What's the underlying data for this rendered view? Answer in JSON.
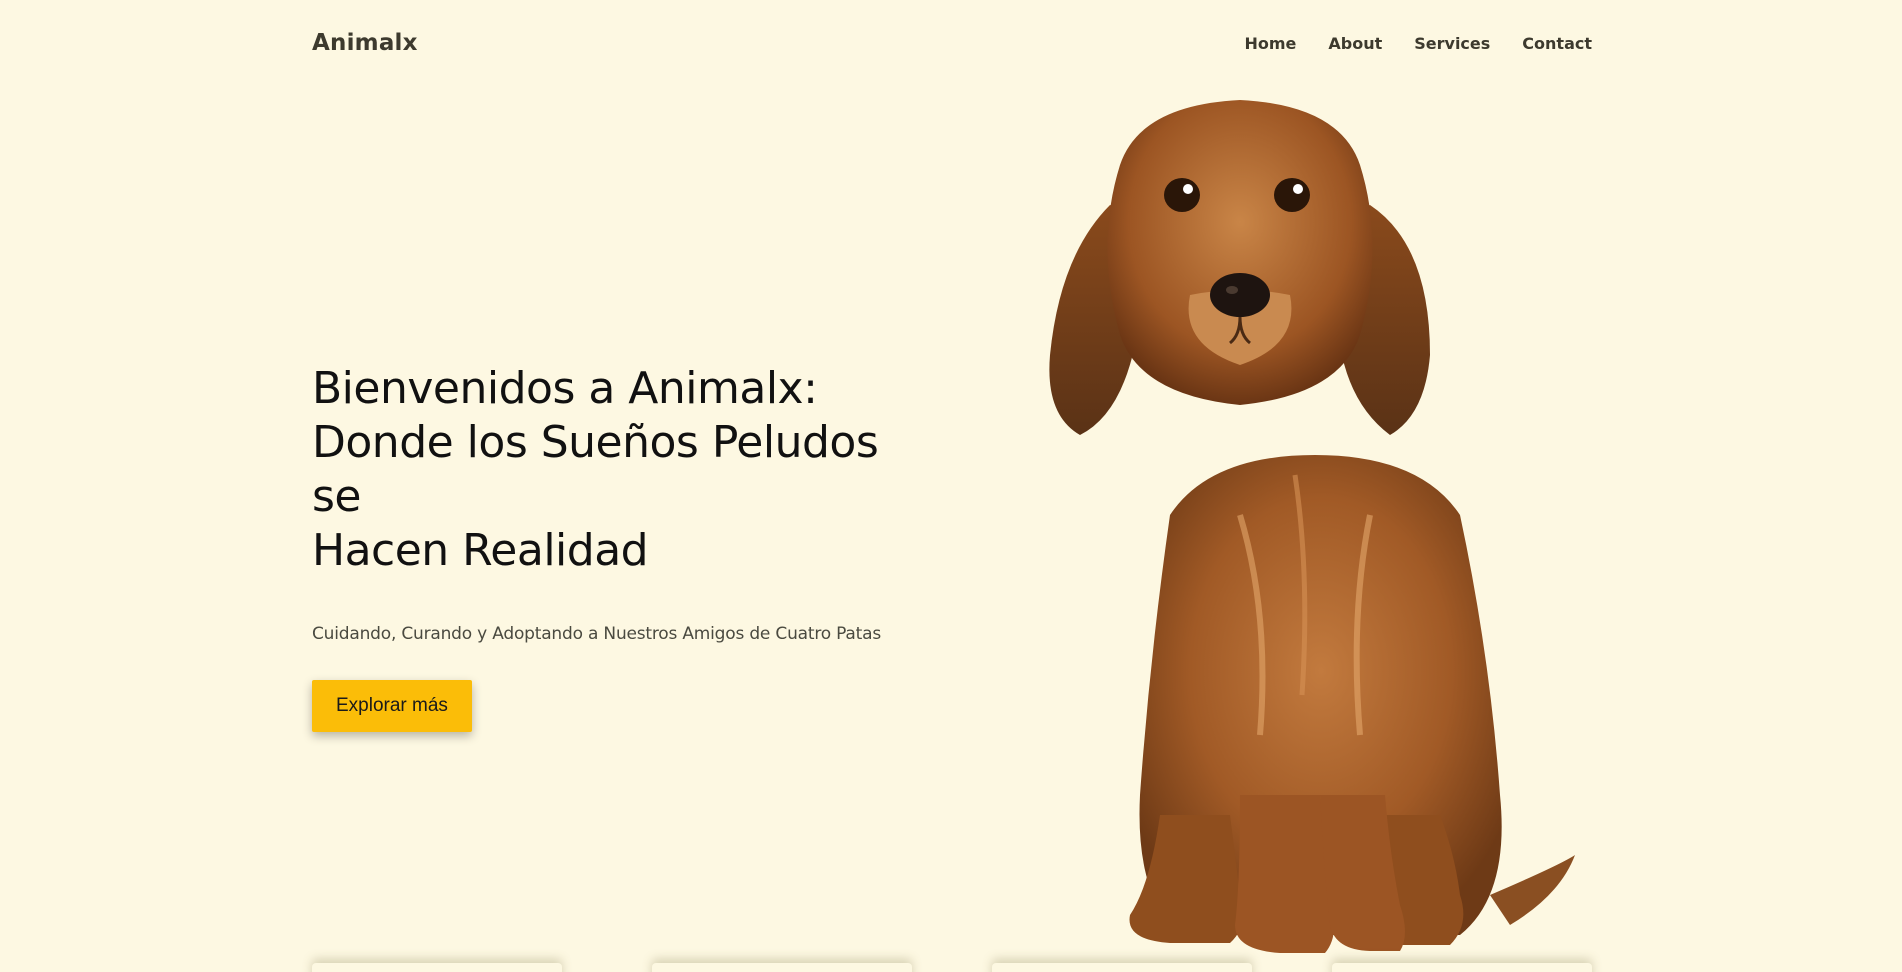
{
  "header": {
    "brand": "Animalx",
    "nav": [
      {
        "label": "Home"
      },
      {
        "label": "About"
      },
      {
        "label": "Services"
      },
      {
        "label": "Contact"
      }
    ]
  },
  "hero": {
    "title_lines": [
      "Bienvenidos a Animalx:",
      "Donde los Sueños Peludos se",
      "Hacen Realidad"
    ],
    "subtitle": "Cuidando, Curando y Adoptando a Nuestros Amigos de Cuatro Patas",
    "cta_label": "Explorar más",
    "image_subject": "dachshund-dog-photo"
  },
  "colors": {
    "background": "#fdf8e2",
    "accent": "#fbbd08",
    "text": "#111111",
    "nav_text": "#3d3a2e"
  }
}
